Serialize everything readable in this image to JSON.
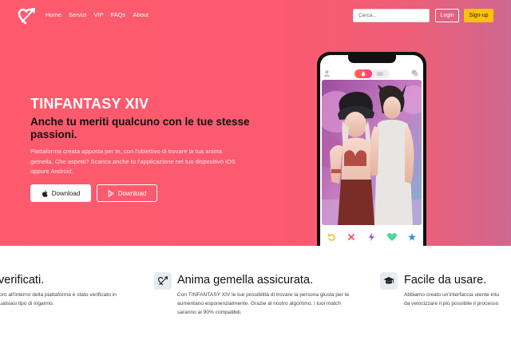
{
  "nav": {
    "links": [
      "Home",
      "Servizi",
      "VIP",
      "FAQs",
      "About"
    ],
    "search_placeholder": "Cerca...",
    "login_label": "Login",
    "signup_label": "Sign-up"
  },
  "hero": {
    "brand": "TINFANTASY XIV",
    "tagline": "Anche tu meriti qualcuno con le tue stesse passioni.",
    "description": "Piattaforma creata apposta per te, con l'obiettivo di trovare la tua anima gemella. Che aspetti? Scarica anche tu l'applicazione nel tuo dispositivo iOS oppure Android.",
    "download_ios_label": "Download",
    "download_android_label": "Download"
  },
  "phone": {
    "action_icons": [
      "undo-icon",
      "close-icon",
      "bolt-icon",
      "heart-icon",
      "star-icon"
    ]
  },
  "features": [
    {
      "title": "verificati.",
      "text_lines": [
        "oro all'interno della piattaforma è stato verificato in",
        "ualsiasi tipo di inganno."
      ]
    },
    {
      "title": "Anima gemella assicurata.",
      "text_lines": [
        "Con TINFANTASY XIV le tue possibilità di trovare la persona giusta per te",
        "aumentano esponenzialmente. Grazie al nostro algoritmo, i tuoi match",
        "saranno al 90% compatibili."
      ]
    },
    {
      "title": "Facile da usare.",
      "text_lines": [
        "Abbiamo creato un'interfaccia utente intu",
        "da velocizzare il più possibile il processo"
      ]
    }
  ],
  "colors": {
    "hero_gradient_start": "#ff5a6e",
    "hero_gradient_end": "#cf6890",
    "signup": "#ffc107",
    "tagline": "#111111"
  }
}
